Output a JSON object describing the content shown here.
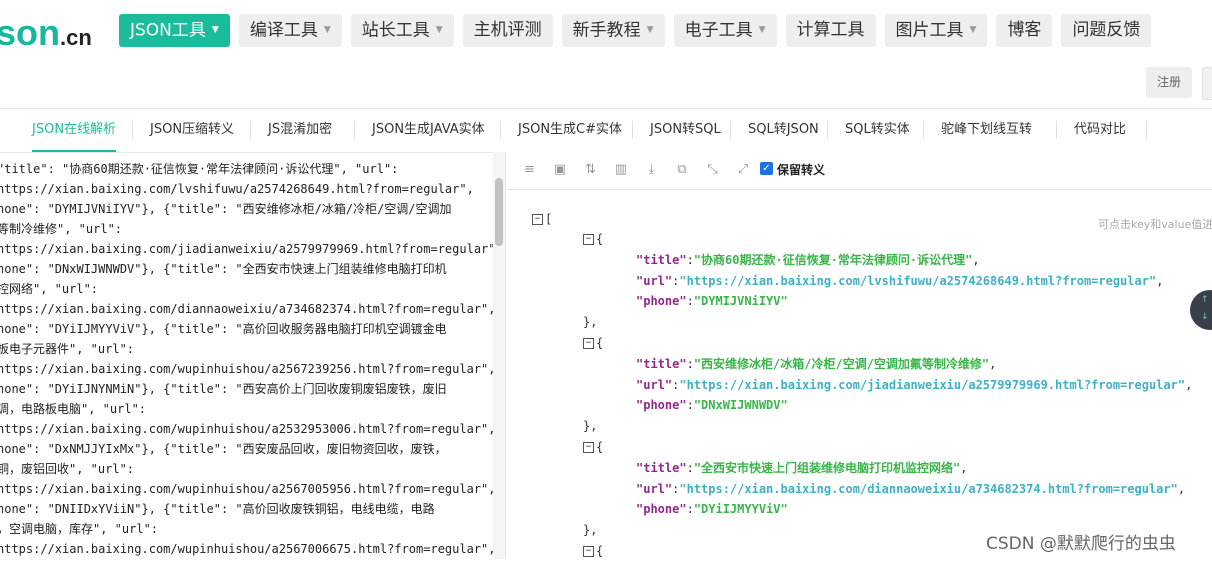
{
  "logo": {
    "main": "son",
    "suffix": ".cn"
  },
  "nav": [
    {
      "label": "JSON工具",
      "dropdown": true,
      "active": true
    },
    {
      "label": "编译工具",
      "dropdown": true
    },
    {
      "label": "站长工具",
      "dropdown": true
    },
    {
      "label": "主机评测",
      "dropdown": false
    },
    {
      "label": "新手教程",
      "dropdown": true
    },
    {
      "label": "电子工具",
      "dropdown": true
    },
    {
      "label": "计算工具",
      "dropdown": false
    },
    {
      "label": "图片工具",
      "dropdown": true
    },
    {
      "label": "博客",
      "dropdown": false
    },
    {
      "label": "问题反馈",
      "dropdown": false
    }
  ],
  "register_label": "注册",
  "tabs": [
    {
      "label": "JSON在线解析",
      "active": true
    },
    {
      "label": "JSON压缩转义"
    },
    {
      "label": "JS混淆加密"
    },
    {
      "label": "JSON生成JAVA实体"
    },
    {
      "label": "JSON生成C#实体"
    },
    {
      "label": "JSON转SQL"
    },
    {
      "label": "SQL转JSON"
    },
    {
      "label": "SQL转实体"
    },
    {
      "label": "驼峰下划线互转"
    },
    {
      "label": "代码对比"
    }
  ],
  "raw_lines": [
    "\"title\": \"协商60期还款·征信恢复·常年法律顾问·诉讼代理\", \"url\":",
    "https://xian.baixing.com/lvshifuwu/a2574268649.html?from=regular\",",
    "hone\": \"DYMIJVNiIYV\"}, {\"title\": \"西安维修冰柜/冰箱/冷柜/空调/空调加",
    "等制冷维修\", \"url\":",
    "https://xian.baixing.com/jiadianweixiu/a2579979969.html?from=regular\",",
    "hone\": \"DNxWIJWNWDV\"}, {\"title\": \"全西安市快速上门组装维修电脑打印机",
    "控网络\", \"url\":",
    "https://xian.baixing.com/diannaoweixiu/a734682374.html?from=regular\",",
    "hone\": \"DYiIJMYYViV\"}, {\"title\": \"高价回收服务器电脑打印机空调镀金电",
    "板电子元器件\", \"url\":",
    "https://xian.baixing.com/wupinhuishou/a2567239256.html?from=regular\",",
    "hone\": \"DYiIJNYNMiN\"}, {\"title\": \"西安高价上门回收废铜废铝废铁，废旧",
    "调，电路板电脑\", \"url\":",
    "https://xian.baixing.com/wupinhuishou/a2532953006.html?from=regular\",",
    "hone\": \"DxNMJJYIxMx\"}, {\"title\": \"西安废品回收，废旧物资回收，废铁，",
    "铜，废铝回收\", \"url\":",
    "https://xian.baixing.com/wupinhuishou/a2567005956.html?from=regular\",",
    "hone\": \"DNIIDxYViiN\"}, {\"title\": \"高价回收废铁铜铝，电线电缆，电路",
    "，空调电脑，库存\", \"url\":",
    "https://xian.baixing.com/wupinhuishou/a2567006675.html?from=regular\","
  ],
  "toolbar": {
    "icons": [
      "database-icon",
      "excel-icon",
      "sort-icon",
      "trash-icon",
      "download-icon",
      "copy-icon",
      "collapse-icon",
      "expand-icon"
    ],
    "keep_escape_label": "保留转义",
    "keep_escape_checked": true
  },
  "hint": "可点击key和value值进",
  "tree": {
    "open_bracket": "[",
    "items": [
      {
        "title": "协商60期还款·征信恢复·常年法律顾问·诉讼代理",
        "url": "https://xian.baixing.com/lvshifuwu/a2574268649.html?from=regular",
        "phone": "DYMIJVNiIYV"
      },
      {
        "title": "西安维修冰柜/冰箱/冷柜/空调/空调加氟等制冷维修",
        "url": "https://xian.baixing.com/jiadianweixiu/a2579979969.html?from=regular",
        "phone": "DNxWIJWNWDV"
      },
      {
        "title": "全西安市快速上门组装维修电脑打印机监控网络",
        "url": "https://xian.baixing.com/diannaoweixiu/a734682374.html?from=regular",
        "phone": "DYiIJMYYViV"
      }
    ]
  },
  "watermark": "CSDN @默默爬行的虫虫"
}
